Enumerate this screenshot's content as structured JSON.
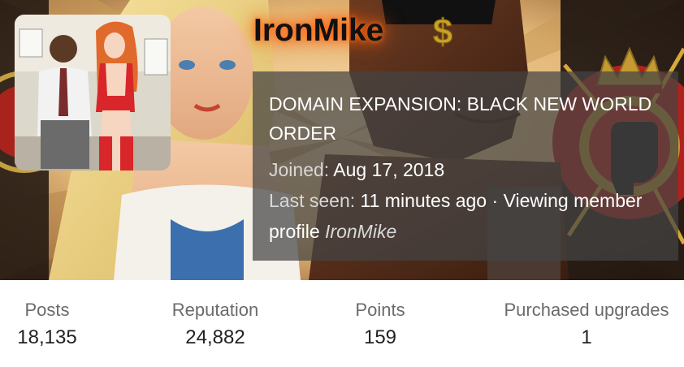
{
  "profile": {
    "username": "IronMike",
    "badge_icon": "dollar-sign-icon",
    "tagline": "DOMAIN EXPANSION: BLACK NEW WORLD ORDER",
    "joined_label": "Joined:",
    "joined_value": "Aug 17, 2018",
    "last_seen_label": "Last seen:",
    "last_seen_value": "11 minutes ago",
    "separator": "·",
    "activity_text": "Viewing member profile",
    "activity_target": "IronMike"
  },
  "stats": [
    {
      "label": "Posts",
      "value": "18,135"
    },
    {
      "label": "Reputation",
      "value": "24,882"
    },
    {
      "label": "Points",
      "value": "159"
    },
    {
      "label": "Purchased upgrades",
      "value": "1"
    }
  ],
  "colors": {
    "username_glow": "#ff5a0a",
    "badge_gold": "#c9a227",
    "banner_red": "#b3211c",
    "info_box_bg": "#444444"
  }
}
